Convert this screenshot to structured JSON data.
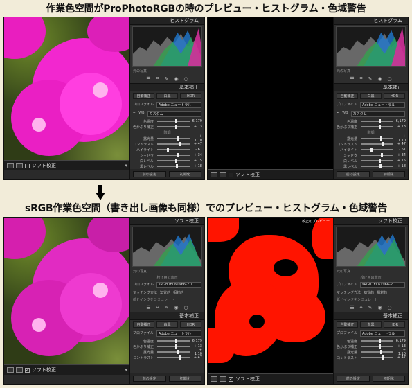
{
  "headings": {
    "top": "作業色空間がProPhotoRGBの時のプレビュー・ヒストグラム・色域警告",
    "middle": "sRGB作業色空間（書き出し画像も同様）でのプレビュー・ヒストグラム・色域警告"
  },
  "colors": {
    "accent_magenta": "#ff2fd6",
    "gamut_warning_red": "#ff1400",
    "panel_bg": "#2e2e2e",
    "page_bg": "#f2ecd9"
  },
  "icons": {
    "arrow": "down-arrow-icon"
  },
  "panels": {
    "histogram_title": "ヒストグラム",
    "softproof_title": "ソフト校正",
    "basic_title": "基本補正",
    "original_photo_label": "元の写真",
    "proof_settings_label": "校正用の表示",
    "profile_label": "プロファイル",
    "profile_value": "sRGB IEC61966-2.1",
    "intent_label": "マッチング方法",
    "intent_values": [
      "知覚的",
      "相対的"
    ],
    "paper_ink_label": "紙とインクをシミュレート",
    "proof_badge": "校正のプレビュー",
    "tabs": [
      "自動補正",
      "白黒",
      "HDR"
    ],
    "profile_row_label": "プロファイル",
    "profile_row_value": "Adobe ニュートラル",
    "wb_label": "WB",
    "wb_value": "カスタム",
    "sliders": [
      {
        "label": "色温度",
        "value": "6,179",
        "pos": 0.56
      },
      {
        "label": "色かぶり補正",
        "value": "+ 13",
        "pos": 0.55
      },
      {
        "label": "階調",
        "value": "",
        "pos": 0.5
      },
      {
        "label": "露光量",
        "value": "+ 1.10",
        "pos": 0.6
      },
      {
        "label": "コントラスト",
        "value": "+ 47",
        "pos": 0.65
      },
      {
        "label": "ハイライト",
        "value": "- 61",
        "pos": 0.3
      },
      {
        "label": "シャドウ",
        "value": "+ 34",
        "pos": 0.62
      },
      {
        "label": "白レベル",
        "value": "+ 15",
        "pos": 0.55
      },
      {
        "label": "黒レベル",
        "value": "+ 18",
        "pos": 0.58
      }
    ],
    "appearance_label": "外観",
    "prev_settings": "前の設定",
    "reset_button": "初期化",
    "softproof_toggle": "ソフト校正"
  }
}
